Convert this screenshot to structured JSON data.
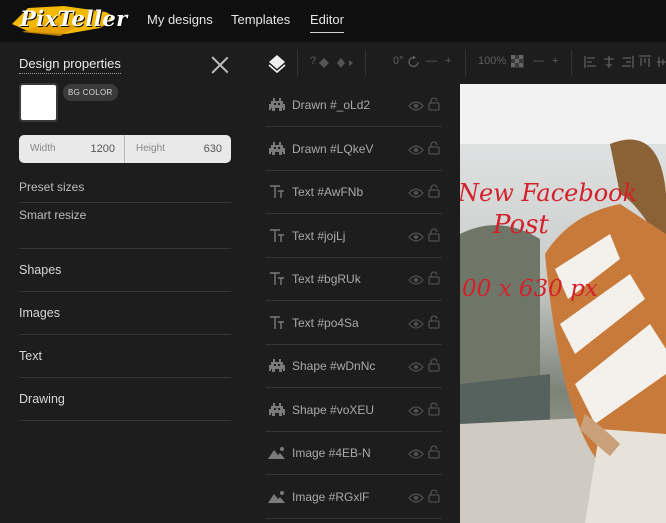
{
  "brand": {
    "name": "PixTeller",
    "accent": "#f5b800"
  },
  "nav": {
    "my_designs": "My designs",
    "templates": "Templates",
    "editor": "Editor"
  },
  "sidebar": {
    "title": "Design properties",
    "bg_color_label": "BG COLOR",
    "bg_color": "#ffffff",
    "width_label": "Width",
    "width_value": "1200",
    "height_label": "Height",
    "height_value": "630",
    "preset_sizes": "Preset sizes",
    "smart_resize": "Smart resize",
    "sections": [
      "Shapes",
      "Images",
      "Text",
      "Drawing"
    ]
  },
  "toolbar": {
    "rotation": "0°",
    "minus": "—",
    "plus": "+",
    "opacity": "100%"
  },
  "layers": [
    {
      "name": "Drawn #_oLd2",
      "icon": "drawn-icon"
    },
    {
      "name": "Drawn #LQkeV",
      "icon": "drawn-icon"
    },
    {
      "name": "Text #AwFNb",
      "icon": "text-icon"
    },
    {
      "name": "Text #jojLj",
      "icon": "text-icon"
    },
    {
      "name": "Text #bgRUk",
      "icon": "text-icon"
    },
    {
      "name": "Text #po4Sa",
      "icon": "text-icon"
    },
    {
      "name": "Shape #wDnNc",
      "icon": "shape-icon"
    },
    {
      "name": "Shape #voXEU",
      "icon": "shape-icon"
    },
    {
      "name": "Image #4EB-N",
      "icon": "image-icon"
    },
    {
      "name": "Image #RGxlF",
      "icon": "image-icon"
    }
  ],
  "canvas": {
    "line1": "New Facebook",
    "line2": "Post",
    "line3": "00 x 630 px",
    "text_color": "#d4202b"
  }
}
